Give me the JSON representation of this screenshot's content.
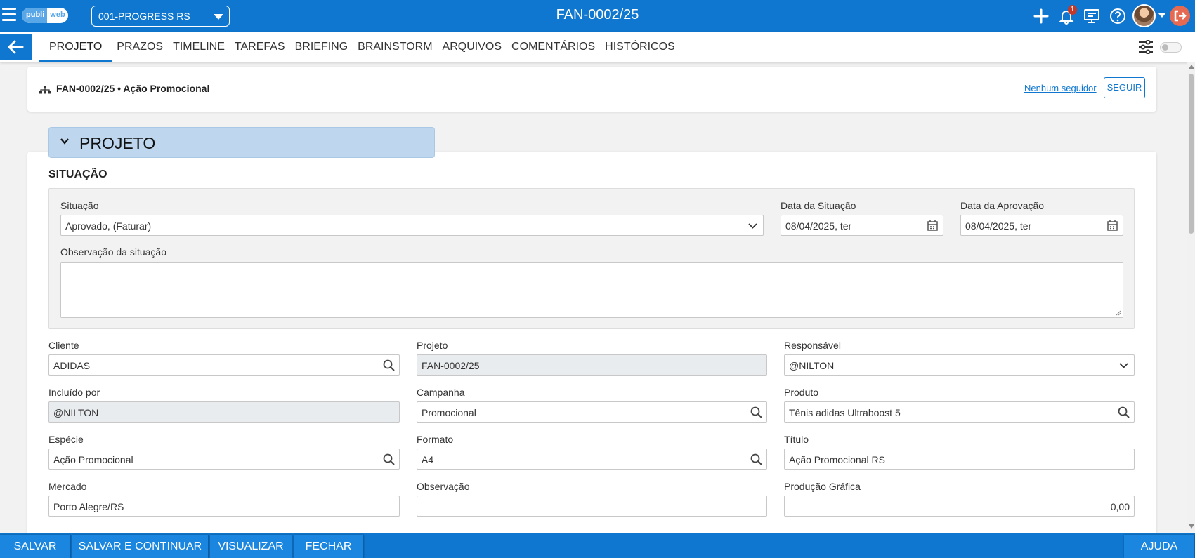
{
  "topbar": {
    "logo_part1": "publi",
    "logo_part2": "web",
    "company": "001-PROGRESS RS",
    "title": "FAN-0002/25",
    "notifications_count": "1",
    "icons": [
      "menu-icon",
      "plus-icon",
      "bell-icon",
      "presentation-icon",
      "help-icon",
      "avatar",
      "chevron-down-icon",
      "logout-icon"
    ]
  },
  "tabs": [
    "PROJETO",
    "PRAZOS",
    "TIMELINE",
    "TAREFAS",
    "BRIEFING",
    "BRAINSTORM",
    "ARQUIVOS",
    "COMENTÁRIOS",
    "HISTÓRICOS"
  ],
  "header": {
    "title": "FAN-0002/25 • Ação Promocional",
    "followers_link": "Nenhum seguidor",
    "follow_button": "SEGUIR"
  },
  "section": {
    "title": "PROJETO",
    "subtitle": "SITUAÇÃO"
  },
  "situacao": {
    "status_label": "Situação",
    "status_value": "Aprovado, (Faturar)",
    "date_status_label": "Data da Situação",
    "date_status_value": "08/04/2025, ter",
    "date_approval_label": "Data da Aprovação",
    "date_approval_value": "08/04/2025, ter",
    "note_label": "Observação da situação",
    "note_value": ""
  },
  "fields": {
    "cliente": {
      "label": "Cliente",
      "value": "ADIDAS"
    },
    "projeto": {
      "label": "Projeto",
      "value": "FAN-0002/25"
    },
    "responsavel": {
      "label": "Responsável",
      "value": "@NILTON"
    },
    "incluido_por": {
      "label": "Incluído por",
      "value": "@NILTON"
    },
    "campanha": {
      "label": "Campanha",
      "value": "Promocional"
    },
    "produto": {
      "label": "Produto",
      "value": "Tênis adidas Ultraboost 5"
    },
    "especie": {
      "label": "Espécie",
      "value": "Ação Promocional"
    },
    "formato": {
      "label": "Formato",
      "value": "A4"
    },
    "titulo": {
      "label": "Título",
      "value": "Ação Promocional RS"
    },
    "mercado": {
      "label": "Mercado",
      "value": "Porto Alegre/RS"
    },
    "observacao": {
      "label": "Observação",
      "value": ""
    },
    "producao_grafica": {
      "label": "Produção Gráfica",
      "value": "0,00"
    }
  },
  "bottom": {
    "save": "SALVAR",
    "save_continue": "SALVAR E CONTINUAR",
    "view": "VISUALIZAR",
    "close": "FECHAR",
    "help": "AJUDA"
  },
  "colors": {
    "primary": "#0f77cf",
    "section_header": "#bed7ee",
    "badge": "#c0392b",
    "logout": "#e66a52"
  }
}
